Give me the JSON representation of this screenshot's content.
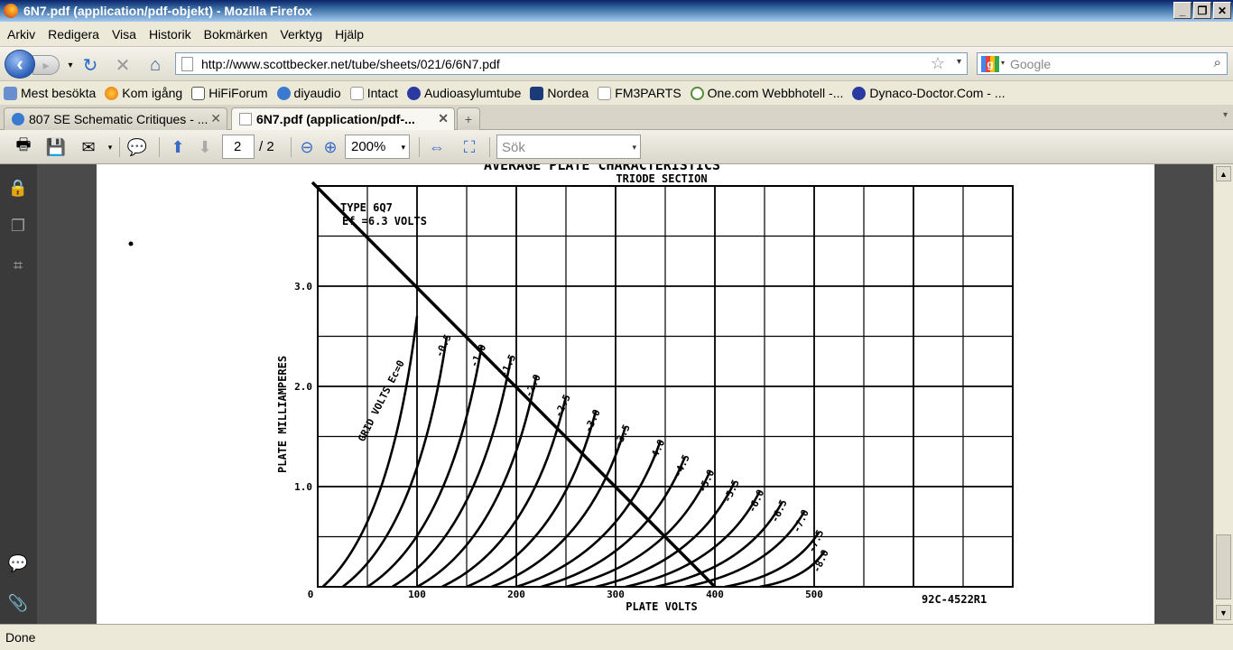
{
  "window": {
    "title": "6N7.pdf (application/pdf-objekt) - Mozilla Firefox",
    "min": "_",
    "restore": "❐",
    "close": "✕"
  },
  "menu": [
    "Arkiv",
    "Redigera",
    "Visa",
    "Historik",
    "Bokmärken",
    "Verktyg",
    "Hjälp"
  ],
  "nav": {
    "url": "http://www.scottbecker.net/tube/sheets/021/6/6N7.pdf",
    "search_placeholder": "Google"
  },
  "bookmarks": [
    "Mest besökta",
    "Kom igång",
    "HiFiForum",
    "diyaudio",
    "Intact",
    "Audioasylumtube",
    "Nordea",
    "FM3PARTS",
    "One.com Webbhotell -...",
    "Dynaco-Doctor.Com - ..."
  ],
  "tabs": [
    {
      "label": "807 SE Schematic Critiques - ..."
    },
    {
      "label": "6N7.pdf (application/pdf-..."
    }
  ],
  "pdf_toolbar": {
    "page_current": "2",
    "page_total": "/ 2",
    "zoom": "200%",
    "find_placeholder": "Sök"
  },
  "status": "Done",
  "chart_data": {
    "type": "line",
    "title": "AVERAGE PLATE CHARACTERISTICS",
    "subtitle": "TRIODE SECTION",
    "annotation_type": "TYPE 6Q7",
    "annotation_ef": "Ef =6.3 VOLTS",
    "curve_family_label": "GRID VOLTS Ec=0",
    "xlabel": "PLATE VOLTS",
    "ylabel": "PLATE MILLIAMPERES",
    "figure_id": "92C-4522R1",
    "xlim": [
      0,
      700
    ],
    "ylim": [
      0,
      4.0
    ],
    "x_ticks": [
      "0",
      "100",
      "200",
      "300",
      "400",
      "500"
    ],
    "y_ticks": [
      "1.0",
      "2.0",
      "3.0"
    ],
    "grid": true,
    "load_line": {
      "x": [
        0,
        400
      ],
      "y": [
        4.0,
        0
      ]
    },
    "series": [
      {
        "name": "Ec=0",
        "x": [
          5,
          100
        ],
        "y": [
          0,
          2.7
        ]
      },
      {
        "name": "-0.5",
        "x": [
          25,
          130
        ],
        "y": [
          0,
          2.5
        ]
      },
      {
        "name": "-1.0",
        "x": [
          50,
          165
        ],
        "y": [
          0,
          2.4
        ]
      },
      {
        "name": "-1.5",
        "x": [
          75,
          195
        ],
        "y": [
          0,
          2.3
        ]
      },
      {
        "name": "-2.0",
        "x": [
          100,
          220
        ],
        "y": [
          0,
          2.1
        ]
      },
      {
        "name": "-2.5",
        "x": [
          125,
          250
        ],
        "y": [
          0,
          1.9
        ]
      },
      {
        "name": "-3.0",
        "x": [
          150,
          280
        ],
        "y": [
          0,
          1.75
        ]
      },
      {
        "name": "-3.5",
        "x": [
          175,
          310
        ],
        "y": [
          0,
          1.6
        ]
      },
      {
        "name": "-4.0",
        "x": [
          200,
          345
        ],
        "y": [
          0,
          1.45
        ]
      },
      {
        "name": "-4.5",
        "x": [
          225,
          370
        ],
        "y": [
          0,
          1.3
        ]
      },
      {
        "name": "-5.0",
        "x": [
          250,
          395
        ],
        "y": [
          0,
          1.15
        ]
      },
      {
        "name": "-5.5",
        "x": [
          280,
          420
        ],
        "y": [
          0,
          1.05
        ]
      },
      {
        "name": "-6.0",
        "x": [
          310,
          445
        ],
        "y": [
          0,
          0.95
        ]
      },
      {
        "name": "-6.5",
        "x": [
          340,
          468
        ],
        "y": [
          0,
          0.85
        ]
      },
      {
        "name": "-7.0",
        "x": [
          370,
          490
        ],
        "y": [
          0,
          0.75
        ]
      },
      {
        "name": "-7.5",
        "x": [
          410,
          505
        ],
        "y": [
          0,
          0.55
        ]
      },
      {
        "name": "-8.0",
        "x": [
          445,
          510
        ],
        "y": [
          0,
          0.35
        ]
      }
    ]
  }
}
